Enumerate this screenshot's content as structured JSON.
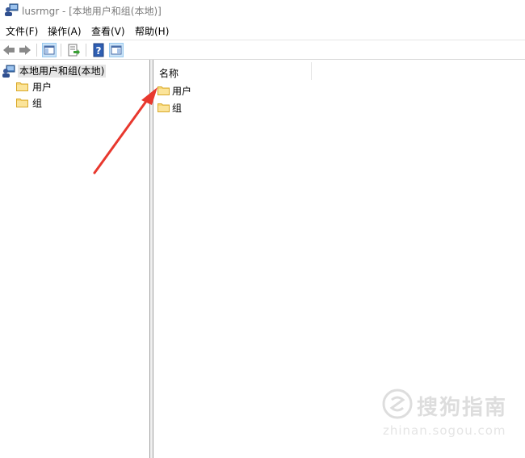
{
  "window": {
    "title": "lusrmgr - [本地用户和组(本地)]"
  },
  "menu": {
    "items": [
      "文件(F)",
      "操作(A)",
      "查看(V)",
      "帮助(H)"
    ]
  },
  "toolbar": {
    "buttons": [
      "back-icon",
      "forward-icon",
      "show-hide-tree-icon",
      "export-list-icon",
      "help-icon",
      "properties-icon"
    ]
  },
  "tree": {
    "root": {
      "label": "本地用户和组(本地)",
      "icon": "users-computer-icon"
    },
    "children": [
      {
        "label": "用户",
        "icon": "folder-icon"
      },
      {
        "label": "组",
        "icon": "folder-icon"
      }
    ]
  },
  "list": {
    "column_header": "名称",
    "items": [
      {
        "label": "用户",
        "icon": "folder-icon"
      },
      {
        "label": "组",
        "icon": "folder-icon"
      }
    ]
  },
  "annotation": {
    "type": "arrow",
    "color": "#e8382e"
  },
  "watermark": {
    "text": "搜狗指南",
    "url": "zhinan.sogou.com"
  }
}
